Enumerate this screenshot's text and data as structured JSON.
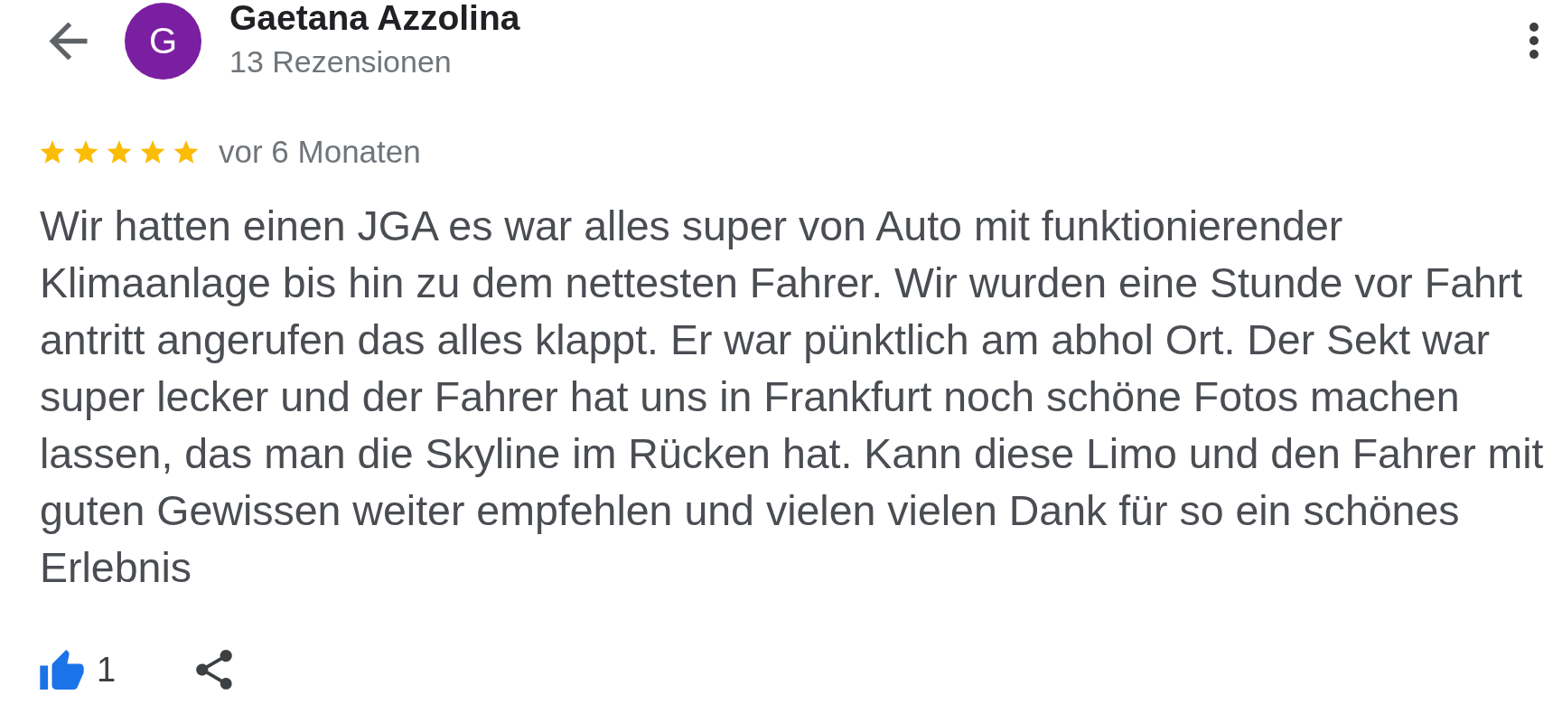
{
  "reviewer": {
    "avatar_letter": "G",
    "name": "Gaetana Azzolina",
    "review_count": "13 Rezensionen"
  },
  "review": {
    "stars": 5,
    "time": "vor 6 Monaten",
    "text": "Wir hatten einen JGA es war alles super von Auto mit funktionierender Klimaanlage bis hin zu dem nettesten Fahrer. Wir wurden eine Stunde vor Fahrt antritt angerufen das alles klappt. Er war pünktlich am abhol Ort. Der Sekt war super lecker und der Fahrer hat uns in Frankfurt noch schöne Fotos machen lassen, das man die Skyline im Rücken hat. Kann diese Limo und den Fahrer mit guten Gewissen weiter empfehlen und vielen vielen Dank für so ein schönes Erlebnis"
  },
  "actions": {
    "liked": true,
    "like_count": "1"
  }
}
